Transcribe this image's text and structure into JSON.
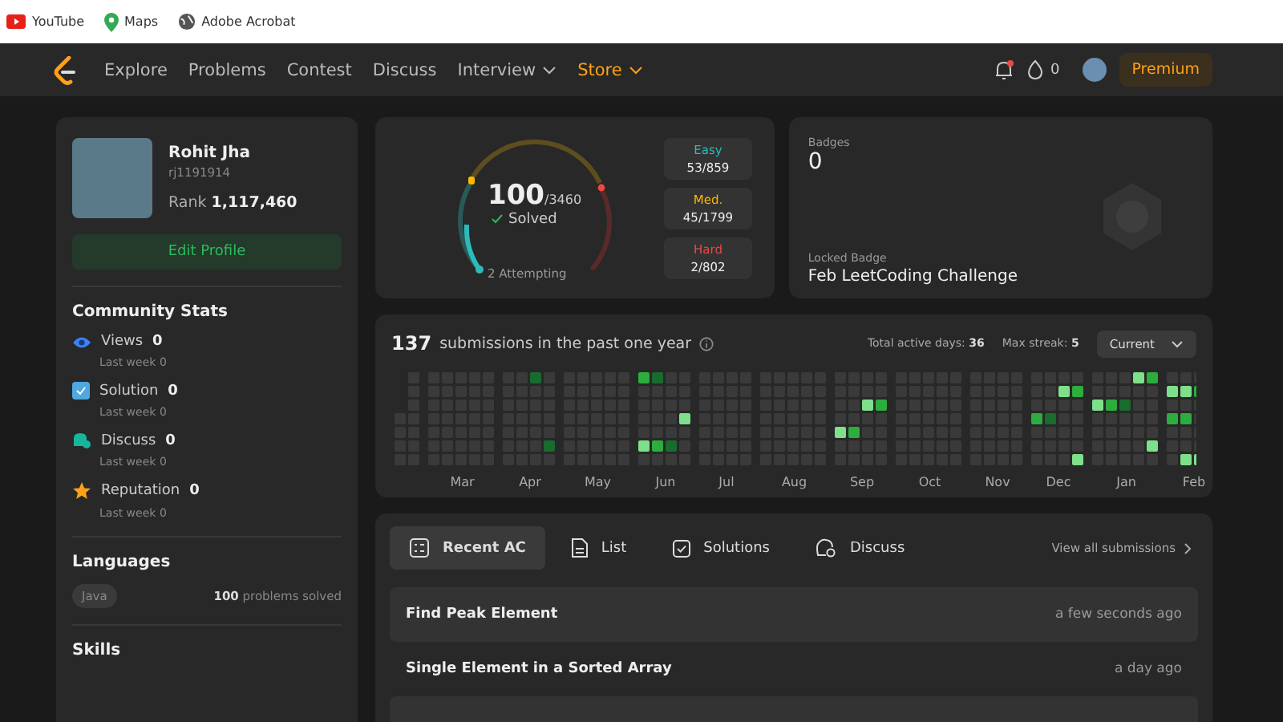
{
  "bookmarks": [
    {
      "label": "YouTube",
      "kind": "youtube"
    },
    {
      "label": "Maps",
      "kind": "maps"
    },
    {
      "label": "Adobe Acrobat",
      "kind": "globe"
    }
  ],
  "nav": {
    "items": [
      {
        "label": "Explore",
        "dropdown": false,
        "highlighted": false
      },
      {
        "label": "Problems",
        "dropdown": false,
        "highlighted": false
      },
      {
        "label": "Contest",
        "dropdown": false,
        "highlighted": false
      },
      {
        "label": "Discuss",
        "dropdown": false,
        "highlighted": false
      },
      {
        "label": "Interview",
        "dropdown": true,
        "highlighted": false
      },
      {
        "label": "Store",
        "dropdown": true,
        "highlighted": true
      }
    ],
    "coins": "0",
    "premium": "Premium"
  },
  "profile": {
    "name": "Rohit Jha",
    "username": "rj1191914",
    "rank_label": "Rank",
    "rank": "1,117,460",
    "edit_button": "Edit Profile"
  },
  "community_stats": {
    "title": "Community Stats",
    "items": [
      {
        "kind": "views",
        "label": "Views",
        "value": "0",
        "sub_label": "Last week",
        "sub_value": "0"
      },
      {
        "kind": "solution",
        "label": "Solution",
        "value": "0",
        "sub_label": "Last week",
        "sub_value": "0"
      },
      {
        "kind": "discuss",
        "label": "Discuss",
        "value": "0",
        "sub_label": "Last week",
        "sub_value": "0"
      },
      {
        "kind": "reputation",
        "label": "Reputation",
        "value": "0",
        "sub_label": "Last week",
        "sub_value": "0"
      }
    ]
  },
  "languages": {
    "title": "Languages",
    "items": [
      {
        "tag": "Java",
        "count": "100",
        "suffix": "problems solved"
      }
    ]
  },
  "skills": {
    "title": "Skills"
  },
  "solved": {
    "total": "100",
    "out_of": "/3460",
    "label": "Solved",
    "attempting": "2 Attempting",
    "difficulties": [
      {
        "kind": "easy",
        "label": "Easy",
        "value": "53/859"
      },
      {
        "kind": "medium",
        "label": "Med.",
        "value": "45/1799"
      },
      {
        "kind": "hard",
        "label": "Hard",
        "value": "2/802"
      }
    ]
  },
  "badges": {
    "title": "Badges",
    "count": "0",
    "locked_label": "Locked Badge",
    "locked_name": "Feb LeetCoding Challenge"
  },
  "submissions": {
    "count": "137",
    "text": "submissions in the past one year",
    "active_label": "Total active days:",
    "active": "36",
    "streak_label": "Max streak:",
    "streak": "5",
    "select": "Current",
    "months": [
      "Mar",
      "Apr",
      "May",
      "Jun",
      "Jul",
      "Aug",
      "Sep",
      "Oct",
      "Nov",
      "Dec",
      "Jan",
      "Feb"
    ]
  },
  "activity": {
    "tabs": [
      {
        "label": "Recent AC",
        "kind": "recent",
        "selected": true
      },
      {
        "label": "List",
        "kind": "list",
        "selected": false
      },
      {
        "label": "Solutions",
        "kind": "solutions",
        "selected": false
      },
      {
        "label": "Discuss",
        "kind": "discuss",
        "selected": false
      }
    ],
    "view_all": "View all submissions",
    "rows": [
      {
        "title": "Find Peak Element",
        "time": "a few seconds ago"
      },
      {
        "title": "Single Element in a Sorted Array",
        "time": "a day ago"
      }
    ]
  }
}
